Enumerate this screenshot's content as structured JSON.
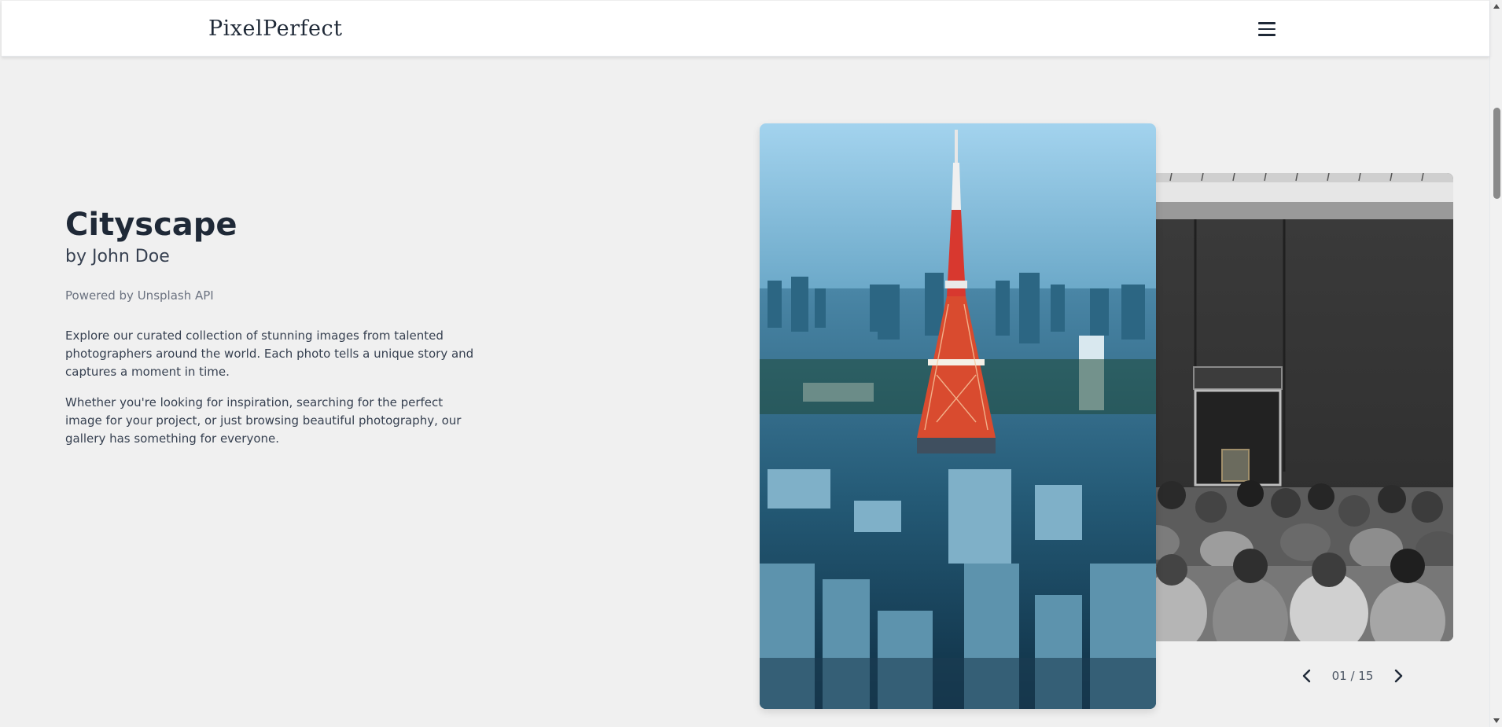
{
  "header": {
    "logo": "PixelPerfect",
    "menu_icon": "hamburger-menu-icon"
  },
  "photo": {
    "title": "Cityscape",
    "author": "by John Doe",
    "powered_by": "Powered by Unsplash API",
    "description": [
      "Explore our curated collection of stunning images from talented photographers around the world. Each photo tells a unique story and captures a moment in time.",
      "Whether you're looking for inspiration, searching for the perfect image for your project, or just browsing beautiful photography, our gallery has something for everyone."
    ]
  },
  "gallery": {
    "current_image": "Tokyo tower cityscape at dusk",
    "next_image": "Crowd viewing painting in museum gallery",
    "counter": "01 / 15",
    "prev_icon": "chevron-left-icon",
    "next_icon": "chevron-right-icon"
  },
  "colors": {
    "background": "#f0f0f0",
    "text": "#1f2937",
    "muted": "#6b7280"
  }
}
